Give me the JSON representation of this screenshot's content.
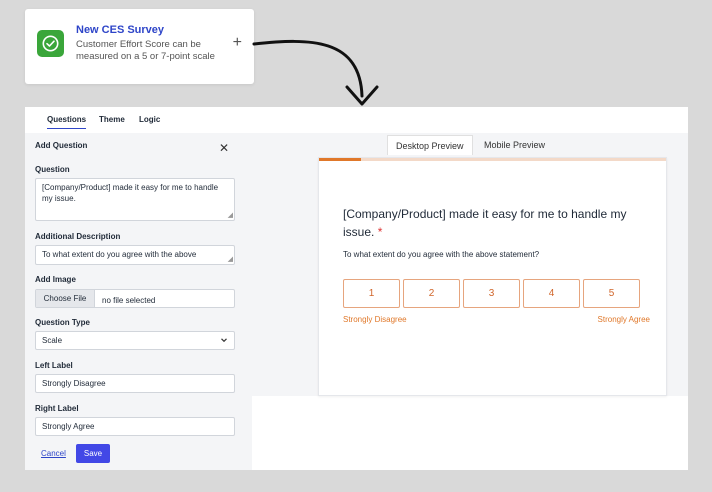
{
  "template_card": {
    "title": "New CES Survey",
    "description": "Customer Effort Score can be measured on a 5 or 7-point scale",
    "add_symbol": "+",
    "icon": "check-circle-icon",
    "icon_color": "#3aa63a"
  },
  "tabs": [
    {
      "label": "Questions",
      "active": true
    },
    {
      "label": "Theme",
      "active": false
    },
    {
      "label": "Logic",
      "active": false
    }
  ],
  "editor": {
    "heading": "Add Question",
    "question_label": "Question",
    "question_value": "[Company/Product] made it easy for me to handle my issue.",
    "description_label": "Additional Description",
    "description_value": "To what extent do you agree with the above",
    "image_label": "Add Image",
    "file_button": "Choose File",
    "file_status": "no file selected",
    "type_label": "Question Type",
    "type_value": "Scale",
    "left_label_label": "Left Label",
    "left_label_value": "Strongly Disagree",
    "right_label_label": "Right Label",
    "right_label_value": "Strongly Agree",
    "cancel": "Cancel",
    "save": "Save"
  },
  "preview": {
    "tabs": [
      {
        "label": "Desktop Preview",
        "active": true
      },
      {
        "label": "Mobile Preview",
        "active": false
      }
    ],
    "progress": 0.12,
    "question": "[Company/Product] made it easy for me to handle my issue.",
    "required_mark": "*",
    "description": "To what extent do you agree with the above statement?",
    "scale": [
      "1",
      "2",
      "3",
      "4",
      "5"
    ],
    "left_label": "Strongly Disagree",
    "right_label": "Strongly Agree"
  },
  "colors": {
    "accent_blue": "#2e45c8",
    "save_button": "#4248e6",
    "preview_orange": "#e0782a"
  }
}
